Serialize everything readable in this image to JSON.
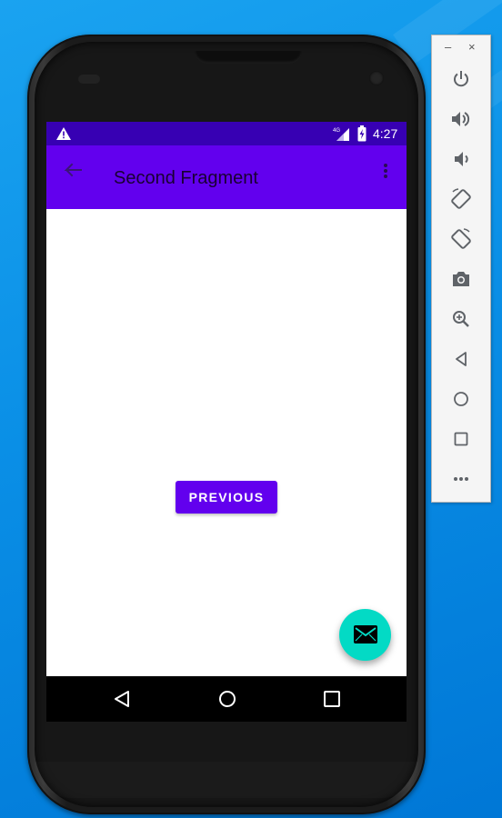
{
  "status_bar": {
    "time": "4:27",
    "network_label": "4G",
    "warning_icon": "warning-icon",
    "battery_icon": "battery-charging-icon",
    "signal_icon": "signal-icon"
  },
  "app_bar": {
    "title": "Second Fragment",
    "nav_icon": "back-arrow-icon",
    "menu_icon": "overflow-menu-icon"
  },
  "content": {
    "previous_button_label": "PREVIOUS"
  },
  "fab": {
    "icon": "mail-icon"
  },
  "navigation_bar": {
    "buttons": [
      "back-triangle-icon",
      "home-circle-icon",
      "recents-square-icon"
    ]
  },
  "emulator_panel": {
    "window_controls": {
      "minimize": "–",
      "close": "×"
    },
    "tools": [
      "power-icon",
      "volume-up-icon",
      "volume-down-icon",
      "rotate-left-icon",
      "rotate-right-icon",
      "camera-icon",
      "zoom-icon",
      "back-icon",
      "home-icon",
      "overview-icon",
      "more-icon"
    ]
  },
  "colors": {
    "status_bar": "#3700b3",
    "app_bar": "#6200ee",
    "button": "#6200ee",
    "fab": "#03dac5",
    "desktop": "#0a8fe6"
  }
}
